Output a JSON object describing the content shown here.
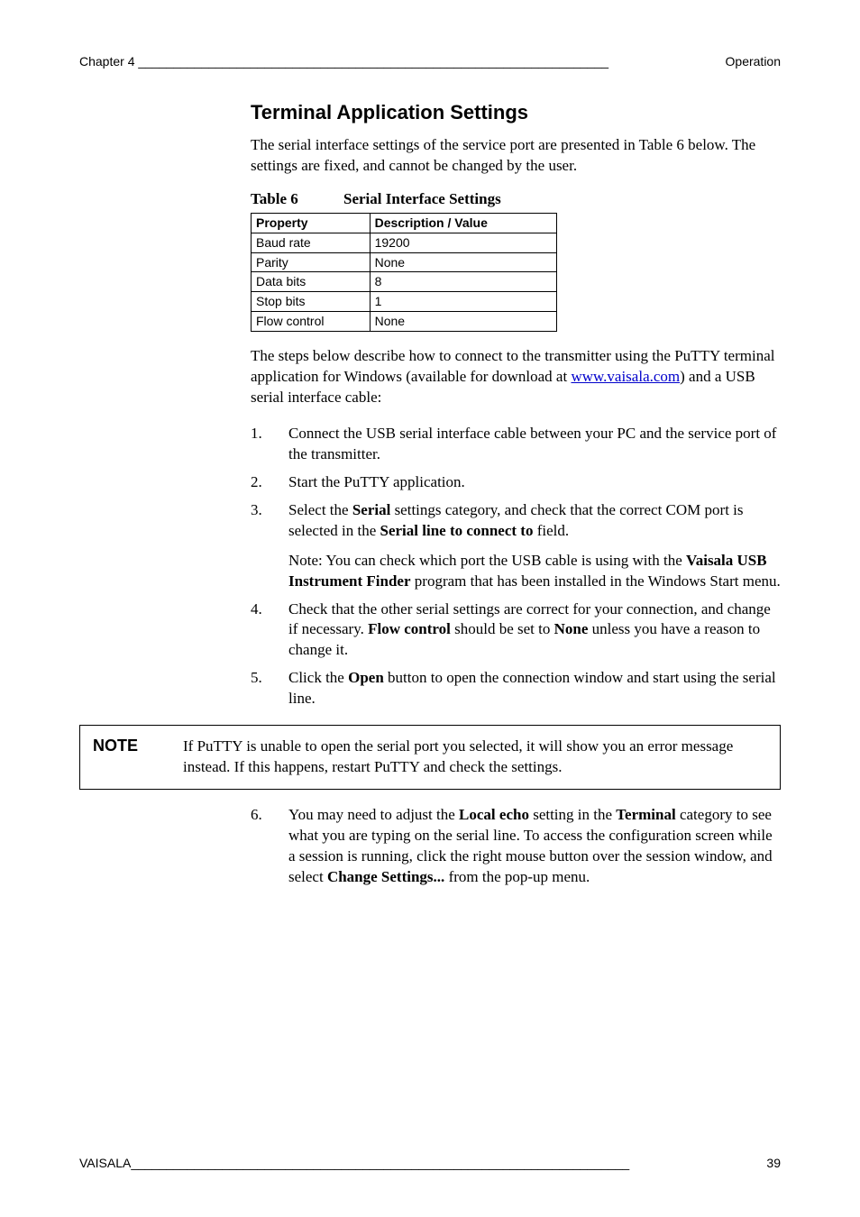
{
  "header": {
    "left": "Chapter 4 ___________________________________________________________________",
    "right": "Operation"
  },
  "title": "Terminal Application Settings",
  "intro": "The serial interface settings of the service port are presented in Table 6 below. The settings are fixed, and cannot be changed by the user.",
  "table_caption": {
    "num": "Table 6",
    "text": "Serial Interface Settings"
  },
  "table": {
    "headers": [
      "Property",
      "Description / Value"
    ],
    "rows": [
      [
        "Baud rate",
        "19200"
      ],
      [
        "Parity",
        "None"
      ],
      [
        "Data bits",
        "8"
      ],
      [
        "Stop bits",
        "1"
      ],
      [
        "Flow control",
        "None"
      ]
    ]
  },
  "after_table_pre": "The steps below describe how to connect to the transmitter using the PuTTY terminal application for Windows (available for download at ",
  "link": "www.vaisala.com",
  "after_table_post": ") and a USB serial interface cable:",
  "steps": {
    "s1": "Connect the USB serial interface cable between your PC and the service port of the transmitter.",
    "s2": "Start the PuTTY application.",
    "s3a": "Select the ",
    "s3b": "Serial",
    "s3c": " settings category, and check that the correct COM port is selected in the ",
    "s3d": "Serial line to connect to",
    "s3e": " field.",
    "s3_note_a": "Note: You can check which port the USB cable is using with the ",
    "s3_note_b": "Vaisala USB Instrument Finder",
    "s3_note_c": " program that has been installed in the Windows Start menu.",
    "s4a": "Check that the other serial settings are correct for your connection, and change if necessary. ",
    "s4b": "Flow control",
    "s4c": " should be set to ",
    "s4d": "None",
    "s4e": " unless you have a reason to change it.",
    "s5a": "Click the ",
    "s5b": "Open",
    "s5c": " button to open the connection window and start using the serial line.",
    "s6a": "You may need to adjust the ",
    "s6b": "Local echo",
    "s6c": " setting in the ",
    "s6d": "Terminal",
    "s6e": " category to see what you are typing on the serial line. To access the configuration screen while a session is running, click the right mouse button over the session window, and select ",
    "s6f": "Change Settings...",
    "s6g": " from the pop-up menu."
  },
  "note": {
    "label": "NOTE",
    "body": "If PuTTY is unable to open the serial port you selected, it will show you an error message instead. If this happens, restart PuTTY and check the settings."
  },
  "footer": {
    "left": "VAISALA_______________________________________________________________________",
    "right": "39"
  }
}
